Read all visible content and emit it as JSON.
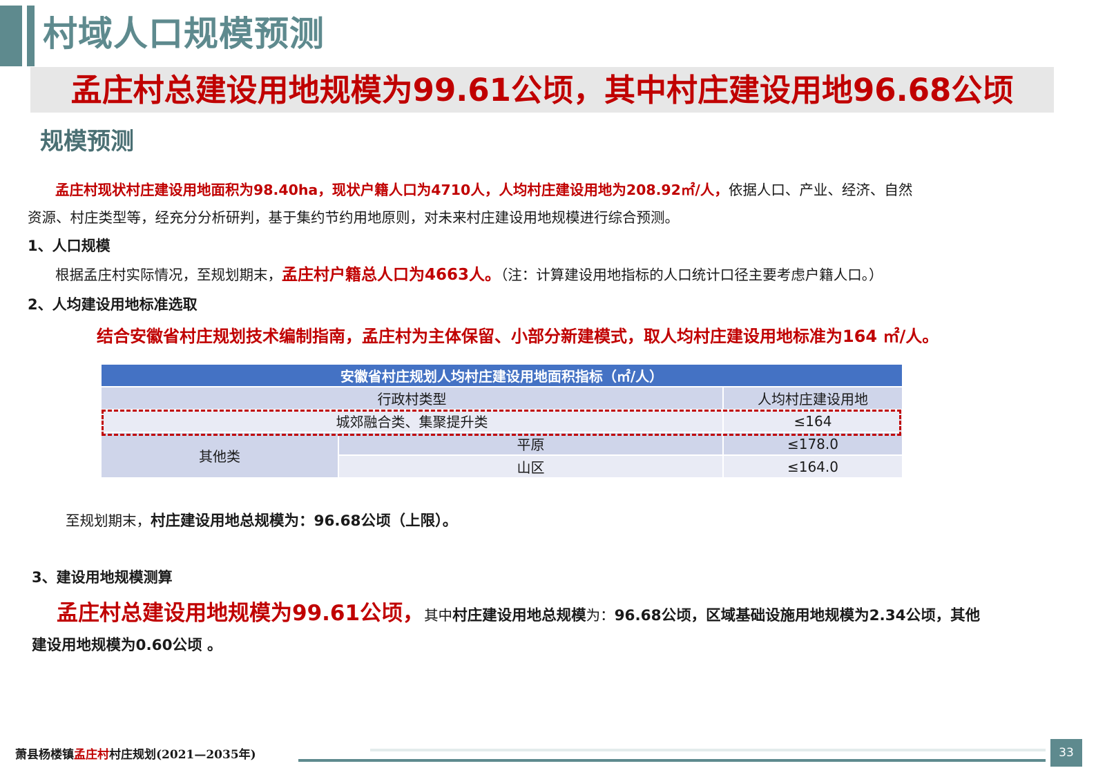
{
  "header": {
    "title": "村域人口规模预测"
  },
  "banner": {
    "text": "孟庄村总建设用地规模为99.61公顷，其中村庄建设用地96.68公顷"
  },
  "section": {
    "title": "规模预测"
  },
  "intro": {
    "red": "孟庄村现状村庄建设用地面积为98.40ha，现状户籍人口为4710人，人均村庄建设用地为208.92㎡/人，",
    "rest1": "依据人口、产业、经济、自然",
    "line2": "资源、村庄类型等，经充分分析研判，基于集约节约用地原则，对未来村庄建设用地规模进行综合预测。"
  },
  "part1": {
    "heading": "1、人口规模",
    "pre": "根据孟庄村实际情况，至规划期末，",
    "red": "孟庄村户籍总人口为4663人。",
    "note": "（注：计算建设用地指标的人口统计口径主要考虑户籍人口。）"
  },
  "part2": {
    "heading": "2、人均建设用地标准选取",
    "red": "结合安徽省村庄规划技术编制指南，孟庄村为主体保留、小部分新建模式，取人均村庄建设用地标准为164 ㎡/人。",
    "conclusion_pre": "至规划期末，",
    "conclusion_bold": "村庄建设用地总规模为：96.68公顷（上限）。"
  },
  "table": {
    "title": "安徽省村庄规划人均村庄建设用地面积指标（㎡/人）",
    "col1": "行政村类型",
    "col2": "人均村庄建设用地",
    "row1_type": "城郊融合类、集聚提升类",
    "row1_value": "≤164",
    "row2_group": "其他类",
    "row2a_sub": "平原",
    "row2a_value": "≤178.0",
    "row2b_sub": "山区",
    "row2b_value": "≤164.0"
  },
  "part3": {
    "heading": "3、建设用地规模测算",
    "red": "孟庄村总建设用地规模为99.61公顷，",
    "mid1": "其中",
    "bold1": "村庄建设用地总规模",
    "mid2": "为：",
    "bold2": "96.68公顷，区域基础设施用地规模为2.34公顷，其他",
    "line2": "建设用地规模为0.60公顷 。"
  },
  "footer": {
    "left1": "萧县杨楼镇",
    "left_red": "孟庄村",
    "left2": "村庄规划(2021—2035年)",
    "page": "33"
  },
  "colors": {
    "accent": "#5e8a8e",
    "red": "#c00000",
    "table_header": "#4472c4"
  }
}
